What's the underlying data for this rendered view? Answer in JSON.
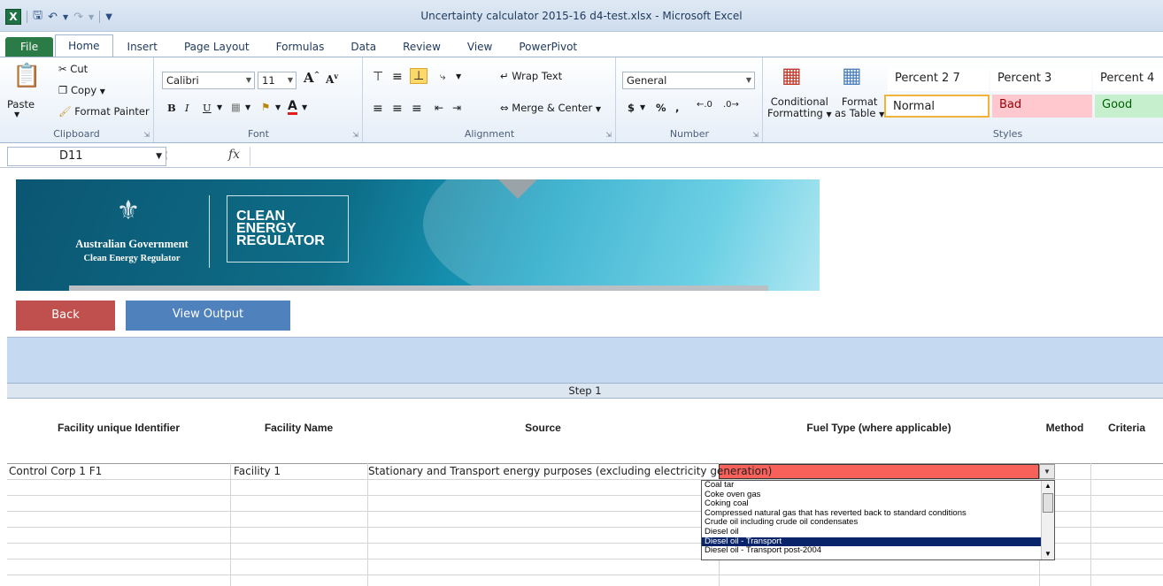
{
  "window": {
    "title": "Uncertainty calculator 2015-16 d4-test.xlsx - Microsoft Excel"
  },
  "quick_access": {
    "app_icon": "X",
    "save_icon": "save-icon",
    "undo_icon": "undo-icon",
    "redo_icon": "redo-icon",
    "customize_icon": "customize-qat-icon"
  },
  "tabs": [
    "File",
    "Home",
    "Insert",
    "Page Layout",
    "Formulas",
    "Data",
    "Review",
    "View",
    "PowerPivot"
  ],
  "active_tab": "Home",
  "ribbon": {
    "clipboard": {
      "label": "Clipboard",
      "paste": "Paste",
      "cut": "Cut",
      "copy": "Copy",
      "format_painter": "Format Painter"
    },
    "font": {
      "label": "Font",
      "font_name": "Calibri",
      "font_size": "11",
      "grow": "A",
      "shrink": "A",
      "bold": "B",
      "italic": "I",
      "underline": "U",
      "font_color": "A"
    },
    "alignment": {
      "label": "Alignment",
      "wrap_text": "Wrap Text",
      "merge_center": "Merge & Center"
    },
    "number": {
      "label": "Number",
      "format": "General",
      "currency": "$",
      "percent": "%",
      "comma": ","
    },
    "styles": {
      "label": "Styles",
      "conditional_formatting_1": "Conditional",
      "conditional_formatting_2": "Formatting",
      "format_table_1": "Format",
      "format_table_2": "as Table",
      "cells": [
        {
          "name": "Percent 2 7",
          "bg": "#ffffff"
        },
        {
          "name": "Percent 3",
          "bg": "#ffffff"
        },
        {
          "name": "Percent 4",
          "bg": "#ffffff"
        },
        {
          "name": "Normal",
          "bg": "#ffffff"
        },
        {
          "name": "Bad",
          "bg": "#ffc7ce",
          "color": "#9c0006"
        },
        {
          "name": "Good",
          "bg": "#c6efce",
          "color": "#006100"
        }
      ]
    }
  },
  "formula_bar": {
    "name_box": "D11",
    "fx": "fx",
    "value": ""
  },
  "banner": {
    "gov_name": "Australian Government",
    "gov_sub": "Clean Energy Regulator",
    "logo_lines": [
      "CLEAN",
      "ENERGY",
      "REGULATOR"
    ]
  },
  "buttons": {
    "back": "Back",
    "view_output": "View Output"
  },
  "step_label": "Step 1",
  "columns": [
    "Facility unique Identifier",
    "Facility Name",
    "Source",
    "Fuel Type (where applicable)",
    "Method",
    "Criteria"
  ],
  "row": {
    "facility_id": "Control Corp 1 F1",
    "facility_name": "Facility 1",
    "source_main": "Stationary and Transport energy purposes (excluding electricity ge",
    "source_tail": "neration)"
  },
  "dropdown": {
    "items": [
      "Coal tar",
      "Coke oven gas",
      "Coking coal",
      "Compressed natural gas that has reverted back to standard conditions",
      "Crude oil including crude oil condensates",
      "Diesel oil",
      "Diesel oil - Transport",
      "Diesel oil - Transport post-2004"
    ],
    "selected_index": 6
  },
  "colors": {
    "file_tab": "#2a7b45",
    "back_button": "#c0504d",
    "view_button": "#4f81bd",
    "highlight": "#f8605a",
    "selection": "#0a246a"
  }
}
